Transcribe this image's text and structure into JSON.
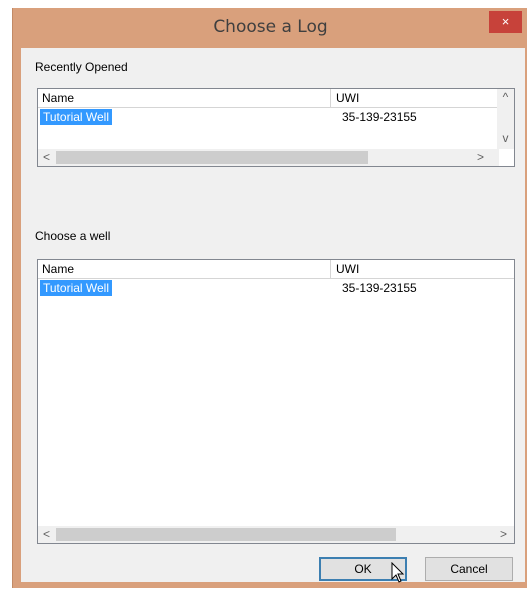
{
  "dialog": {
    "title": "Choose a Log",
    "close_glyph": "×"
  },
  "recent": {
    "label": "Recently Opened",
    "columns": {
      "name": "Name",
      "uwi": "UWI"
    },
    "rows": [
      {
        "name": "Tutorial Well",
        "uwi": "35-139-23155",
        "selected": true
      }
    ]
  },
  "wells": {
    "label": "Choose a well",
    "columns": {
      "name": "Name",
      "uwi": "UWI"
    },
    "rows": [
      {
        "name": "Tutorial Well",
        "uwi": "35-139-23155",
        "selected": true
      }
    ]
  },
  "buttons": {
    "ok": "OK",
    "cancel": "Cancel"
  },
  "scroll": {
    "up": "^",
    "down": "v",
    "left": "<",
    "right": ">"
  },
  "colors": {
    "selection": "#3399ff",
    "titlebar": "#d9a07c",
    "close": "#c7423a"
  },
  "icons": [
    "close-icon",
    "scroll-up-icon",
    "scroll-down-icon",
    "scroll-left-icon",
    "scroll-right-icon",
    "mouse-cursor-icon"
  ]
}
